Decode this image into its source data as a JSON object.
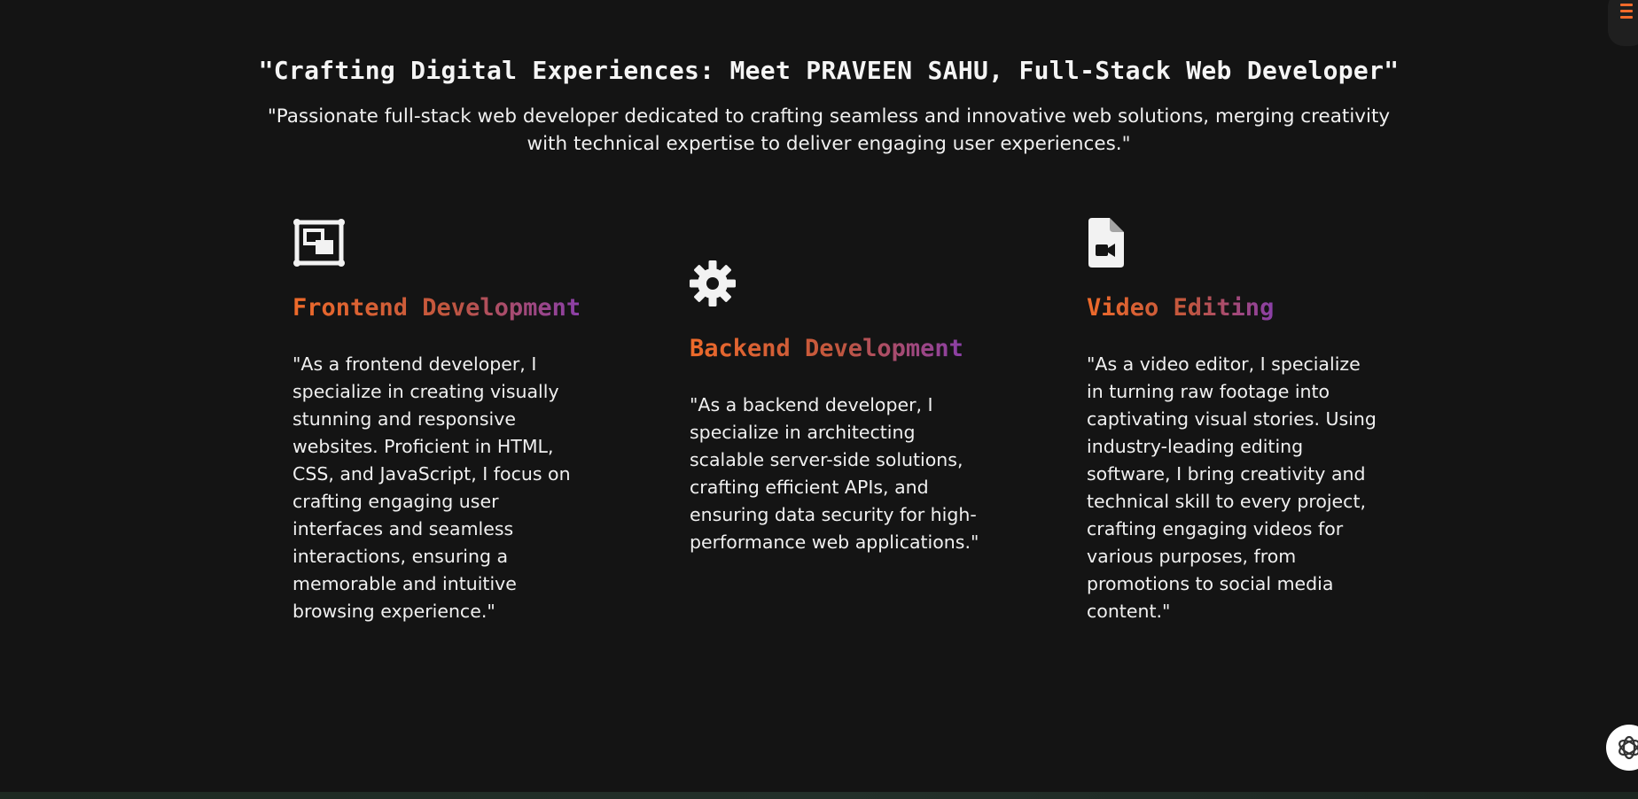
{
  "hero": {
    "title": "\"Crafting Digital Experiences: Meet PRAVEEN SAHU, Full-Stack Web Developer\"",
    "subtitle": "\"Passionate full-stack web developer dedicated to crafting seamless and innovative web solutions, merging creativity with technical expertise to deliver engaging user experiences.\""
  },
  "services": [
    {
      "icon": "frontend-icon",
      "title": "Frontend Development",
      "text": "\"As a frontend developer, I specialize in creating visually stunning and responsive websites. Proficient in HTML, CSS, and JavaScript, I focus on crafting engaging user interfaces and seamless interactions, ensuring a memorable and intuitive browsing experience.\""
    },
    {
      "icon": "gear-icon",
      "title": "Backend Development",
      "text": "\"As a backend developer, I specialize in architecting scalable server-side solutions, crafting efficient APIs, and ensuring data security for high-performance web applications.\""
    },
    {
      "icon": "video-file-icon",
      "title": "Video Editing",
      "text": "\"As a video editor, I specialize in turning raw footage into captivating visual stories. Using industry-leading editing software, I bring creativity and technical skill to every project, crafting engaging videos for various purposes, from promotions to social media content.\""
    }
  ],
  "colors": {
    "background": "#141414",
    "accent_orange": "#ee6a2a",
    "accent_purple": "#8a3fa8",
    "text": "#f0f0f0"
  },
  "widgets": {
    "menu_icon": "hamburger-menu-icon",
    "chat_icon": "chatgpt-logo-icon"
  }
}
